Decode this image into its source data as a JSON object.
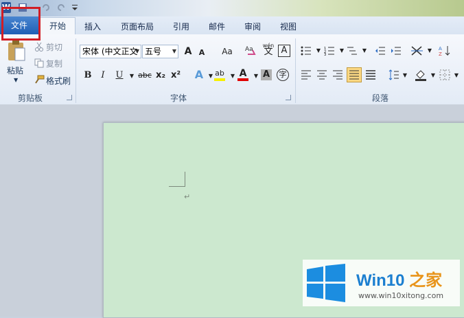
{
  "tabs": [
    "文件",
    "开始",
    "插入",
    "页面布局",
    "引用",
    "邮件",
    "审阅",
    "视图"
  ],
  "clipboard": {
    "paste": "粘贴",
    "cut": "剪切",
    "copy": "复制",
    "format_painter": "格式刷",
    "group_label": "剪贴板"
  },
  "font": {
    "name": "宋体 (中文正文",
    "size": "五号",
    "bold": "B",
    "italic": "I",
    "underline": "U",
    "strike": "abc",
    "sub": "x₂",
    "sup": "x²",
    "change_case": "Aa",
    "grow": "A",
    "shrink": "A",
    "effects": "A",
    "highlight": "ab",
    "color": "A",
    "shade": "A",
    "phonetic": "wén",
    "phonetic_char": "文",
    "border": "A",
    "enclose": "字",
    "group_label": "字体"
  },
  "paragraph": {
    "group_label": "段落"
  },
  "watermark": {
    "title": "Win10",
    "title_suffix": "之家",
    "url": "www.win10xitong.com"
  },
  "colors": {
    "page": "#cce8cf",
    "file_tab": "#1f5fb5",
    "highlight_box": "#d21d24"
  }
}
